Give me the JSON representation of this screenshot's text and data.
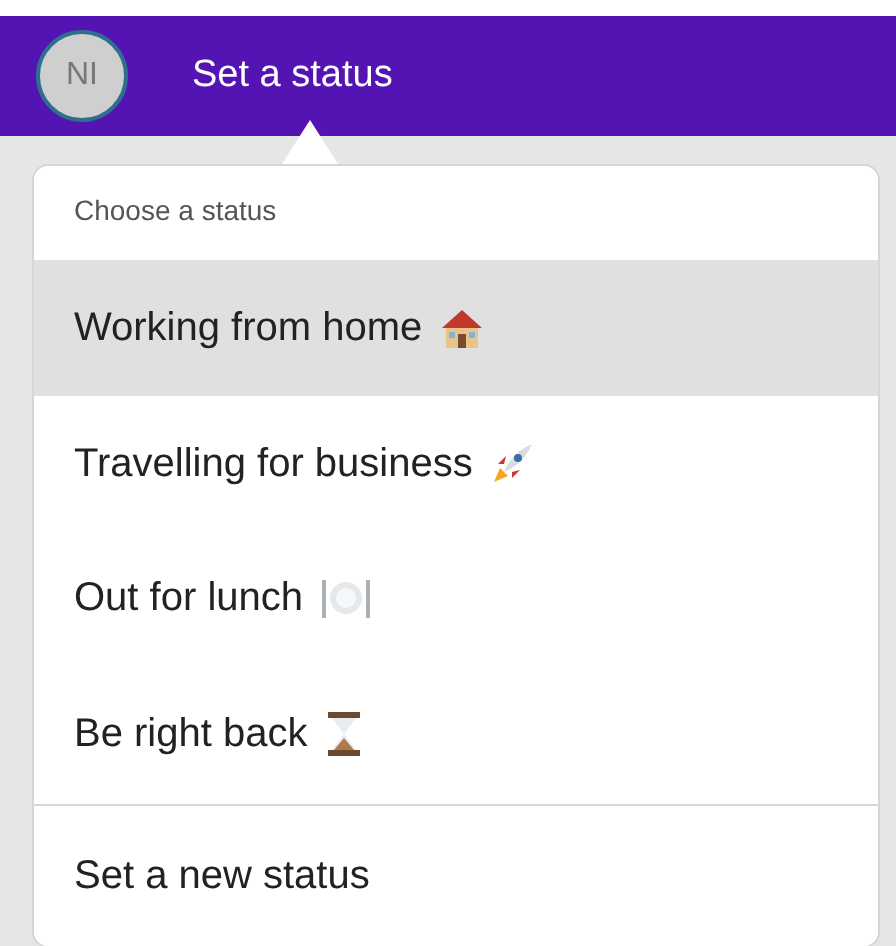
{
  "header": {
    "avatar_initials": "NI",
    "title": "Set a status"
  },
  "menu": {
    "heading": "Choose a status",
    "items": [
      {
        "label": "Working from home",
        "selected": true
      },
      {
        "label": "Travelling for business",
        "selected": false
      },
      {
        "label": "Out for lunch",
        "selected": false
      },
      {
        "label": "Be right back",
        "selected": false
      }
    ],
    "footer_action": "Set a new status"
  }
}
